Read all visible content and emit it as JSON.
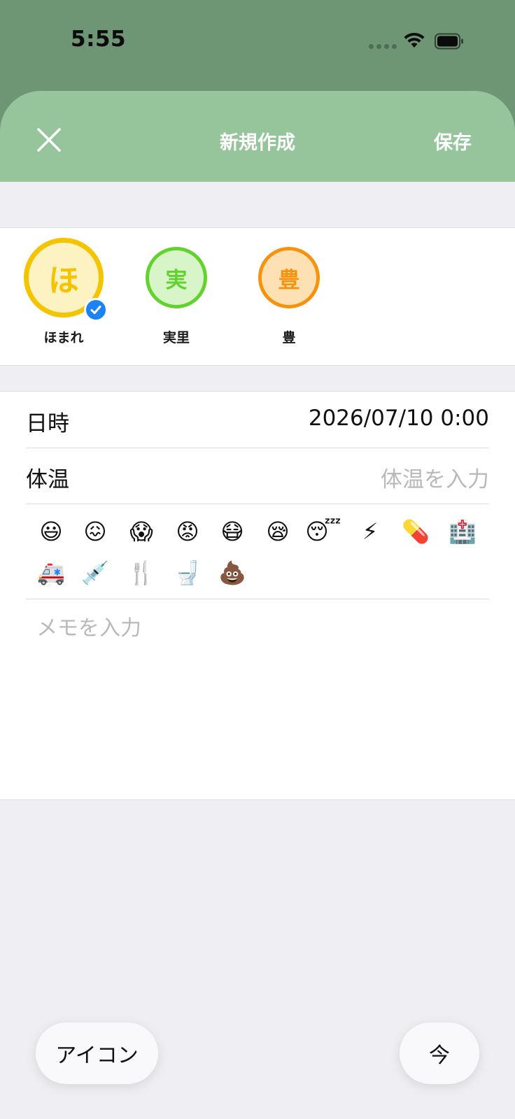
{
  "status_bar": {
    "time": "5:55"
  },
  "header": {
    "title": "新規作成",
    "save_label": "保存"
  },
  "profiles": [
    {
      "initial": "ほ",
      "name": "ほまれ",
      "selected": true,
      "ring": "#f5c400",
      "fill": "#fdf2c2",
      "text_color": "#f5c400"
    },
    {
      "initial": "実",
      "name": "実里",
      "selected": false,
      "ring": "#62d22e",
      "fill": "#d8f5c9",
      "text_color": "#62d22e"
    },
    {
      "initial": "豊",
      "name": "豊",
      "selected": false,
      "ring": "#f6930c",
      "fill": "#fde1b5",
      "text_color": "#f6930c"
    }
  ],
  "form": {
    "datetime_label": "日時",
    "datetime_value": "2026/07/10 0:00",
    "temperature_label": "体温",
    "temperature_placeholder": "体温を入力",
    "memo_placeholder": "メモを入力"
  },
  "emojis": [
    "😃",
    "😖",
    "😱",
    "😡",
    "😷",
    "😪",
    "😴",
    "⚡",
    "💊",
    "🏥",
    "🚑",
    "💉",
    "🍴",
    "🚽",
    "💩"
  ],
  "bottom": {
    "icon_button": "アイコン",
    "now_button": "今"
  },
  "colors": {
    "header_green": "#96c59c",
    "top_green": "#6e9675",
    "check_blue": "#1a83f5"
  }
}
